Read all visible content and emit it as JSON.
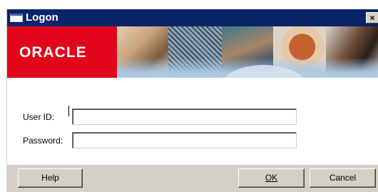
{
  "window": {
    "title": "Logon",
    "close_glyph": "×",
    "title_icon": "window-icon"
  },
  "banner": {
    "logo_text": "ORACLE",
    "logo_color": "#e2061a"
  },
  "form": {
    "user_label": "User ID:",
    "user_value": "",
    "password_label": "Password:",
    "password_value": ""
  },
  "buttons": {
    "help": "Help",
    "ok": "OK",
    "cancel": "Cancel"
  },
  "colors": {
    "titlebar": "#0a246a",
    "dialog_face": "#d4d0c8"
  }
}
